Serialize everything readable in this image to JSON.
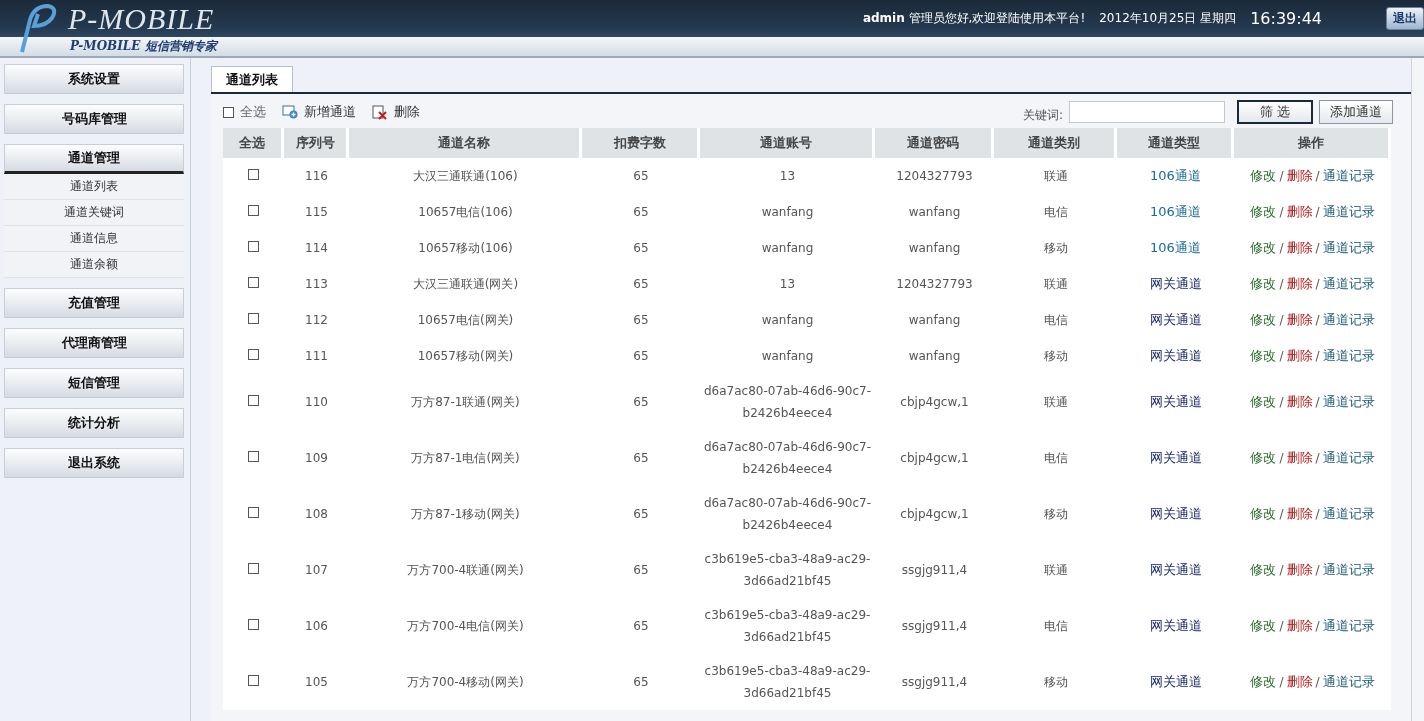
{
  "header": {
    "logo": "P-MOBILE",
    "subtitle": "P-MOBILE 短信营销专家",
    "user": "admin",
    "greeting": "管理员您好,欢迎登陆使用本平台!",
    "date": "2012年10月25日  星期四",
    "time": "16:39:44",
    "logout": "退出"
  },
  "sidebar": [
    {
      "label": "系统设置",
      "expanded": false
    },
    {
      "label": "号码库管理",
      "expanded": false
    },
    {
      "label": "通道管理",
      "expanded": true,
      "children": [
        {
          "label": "通道列表"
        },
        {
          "label": "通道关键词"
        },
        {
          "label": "通道信息"
        },
        {
          "label": "通道余额"
        }
      ]
    },
    {
      "label": "充值管理",
      "expanded": false
    },
    {
      "label": "代理商管理",
      "expanded": false
    },
    {
      "label": "短信管理",
      "expanded": false
    },
    {
      "label": "统计分析",
      "expanded": false
    },
    {
      "label": "退出系统",
      "expanded": false
    }
  ],
  "tab": {
    "label": "通道列表",
    "selected": true
  },
  "toolbar": {
    "select_all": {
      "label": "全选",
      "checked": false
    },
    "add": "新增通道",
    "delete": "删除",
    "keyword_label": "关键词:",
    "filter": "筛 选",
    "add_channel": "添加通道"
  },
  "table": {
    "columns": [
      "全选",
      "序列号",
      "通道名称",
      "扣费字数",
      "通道账号",
      "通道密码",
      "通道类别",
      "通道类型",
      "操作"
    ],
    "rows": [
      {
        "checked": false,
        "id": "116",
        "name": "大汉三通联通(106)",
        "chars": "65",
        "account": [
          "13"
        ],
        "password": "1204327793",
        "carrier": "联通",
        "type": {
          "kind": "sms106",
          "label": "106通道"
        },
        "actions": [
          {
            "kind": "edit",
            "label": "修改"
          },
          {
            "kind": "separator",
            "label": "/"
          },
          {
            "kind": "delete",
            "label": "删除"
          },
          {
            "kind": "separator",
            "label": "/"
          },
          {
            "kind": "log",
            "label": "通道记录"
          }
        ]
      },
      {
        "checked": false,
        "id": "115",
        "name": "10657电信(106)",
        "chars": "65",
        "account": [
          "wanfang"
        ],
        "password": "wanfang",
        "carrier": "电信",
        "type": {
          "kind": "sms106",
          "label": "106通道"
        },
        "actions": [
          {
            "kind": "edit",
            "label": "修改"
          },
          {
            "kind": "separator",
            "label": "/"
          },
          {
            "kind": "delete",
            "label": "删除"
          },
          {
            "kind": "separator",
            "label": "/"
          },
          {
            "kind": "log",
            "label": "通道记录"
          }
        ]
      },
      {
        "checked": false,
        "id": "114",
        "name": "10657移动(106)",
        "chars": "65",
        "account": [
          "wanfang"
        ],
        "password": "wanfang",
        "carrier": "移动",
        "type": {
          "kind": "sms106",
          "label": "106通道"
        },
        "actions": [
          {
            "kind": "edit",
            "label": "修改"
          },
          {
            "kind": "separator",
            "label": "/"
          },
          {
            "kind": "delete",
            "label": "删除"
          },
          {
            "kind": "separator",
            "label": "/"
          },
          {
            "kind": "log",
            "label": "通道记录"
          }
        ]
      },
      {
        "checked": false,
        "id": "113",
        "name": "大汉三通联通(网关)",
        "chars": "65",
        "account": [
          "13"
        ],
        "password": "1204327793",
        "carrier": "联通",
        "type": {
          "kind": "gateway",
          "label": "网关通道"
        },
        "actions": [
          {
            "kind": "edit",
            "label": "修改"
          },
          {
            "kind": "separator",
            "label": "/"
          },
          {
            "kind": "delete",
            "label": "删除"
          },
          {
            "kind": "separator",
            "label": "/"
          },
          {
            "kind": "log",
            "label": "通道记录"
          }
        ]
      },
      {
        "checked": false,
        "id": "112",
        "name": "10657电信(网关)",
        "chars": "65",
        "account": [
          "wanfang"
        ],
        "password": "wanfang",
        "carrier": "电信",
        "type": {
          "kind": "gateway",
          "label": "网关通道"
        },
        "actions": [
          {
            "kind": "edit",
            "label": "修改"
          },
          {
            "kind": "separator",
            "label": "/"
          },
          {
            "kind": "delete",
            "label": "删除"
          },
          {
            "kind": "separator",
            "label": "/"
          },
          {
            "kind": "log",
            "label": "通道记录"
          }
        ]
      },
      {
        "checked": false,
        "id": "111",
        "name": "10657移动(网关)",
        "chars": "65",
        "account": [
          "wanfang"
        ],
        "password": "wanfang",
        "carrier": "移动",
        "type": {
          "kind": "gateway",
          "label": "网关通道"
        },
        "actions": [
          {
            "kind": "edit",
            "label": "修改"
          },
          {
            "kind": "separator",
            "label": "/"
          },
          {
            "kind": "delete",
            "label": "删除"
          },
          {
            "kind": "separator",
            "label": "/"
          },
          {
            "kind": "log",
            "label": "通道记录"
          }
        ]
      },
      {
        "checked": false,
        "id": "110",
        "name": "万方87-1联通(网关)",
        "chars": "65",
        "account": [
          "d6a7ac80-07ab-46d6-90c7-",
          "b2426b4eece4"
        ],
        "password": "cbjp4gcw,1",
        "carrier": "联通",
        "type": {
          "kind": "gateway",
          "label": "网关通道"
        },
        "actions": [
          {
            "kind": "edit",
            "label": "修改"
          },
          {
            "kind": "separator",
            "label": "/"
          },
          {
            "kind": "delete",
            "label": "删除"
          },
          {
            "kind": "separator",
            "label": "/"
          },
          {
            "kind": "log",
            "label": "通道记录"
          }
        ]
      },
      {
        "checked": false,
        "id": "109",
        "name": "万方87-1电信(网关)",
        "chars": "65",
        "account": [
          "d6a7ac80-07ab-46d6-90c7-",
          "b2426b4eece4"
        ],
        "password": "cbjp4gcw,1",
        "carrier": "电信",
        "type": {
          "kind": "gateway",
          "label": "网关通道"
        },
        "actions": [
          {
            "kind": "edit",
            "label": "修改"
          },
          {
            "kind": "separator",
            "label": "/"
          },
          {
            "kind": "delete",
            "label": "删除"
          },
          {
            "kind": "separator",
            "label": "/"
          },
          {
            "kind": "log",
            "label": "通道记录"
          }
        ]
      },
      {
        "checked": false,
        "id": "108",
        "name": "万方87-1移动(网关)",
        "chars": "65",
        "account": [
          "d6a7ac80-07ab-46d6-90c7-",
          "b2426b4eece4"
        ],
        "password": "cbjp4gcw,1",
        "carrier": "移动",
        "type": {
          "kind": "gateway",
          "label": "网关通道"
        },
        "actions": [
          {
            "kind": "edit",
            "label": "修改"
          },
          {
            "kind": "separator",
            "label": "/"
          },
          {
            "kind": "delete",
            "label": "删除"
          },
          {
            "kind": "separator",
            "label": "/"
          },
          {
            "kind": "log",
            "label": "通道记录"
          }
        ]
      },
      {
        "checked": false,
        "id": "107",
        "name": "万方700-4联通(网关)",
        "chars": "65",
        "account": [
          "c3b619e5-cba3-48a9-ac29-",
          "3d66ad21bf45"
        ],
        "password": "ssgjg911,4",
        "carrier": "联通",
        "type": {
          "kind": "gateway",
          "label": "网关通道"
        },
        "actions": [
          {
            "kind": "edit",
            "label": "修改"
          },
          {
            "kind": "separator",
            "label": "/"
          },
          {
            "kind": "delete",
            "label": "删除"
          },
          {
            "kind": "separator",
            "label": "/"
          },
          {
            "kind": "log",
            "label": "通道记录"
          }
        ]
      },
      {
        "checked": false,
        "id": "106",
        "name": "万方700-4电信(网关)",
        "chars": "65",
        "account": [
          "c3b619e5-cba3-48a9-ac29-",
          "3d66ad21bf45"
        ],
        "password": "ssgjg911,4",
        "carrier": "电信",
        "type": {
          "kind": "gateway",
          "label": "网关通道"
        },
        "actions": [
          {
            "kind": "edit",
            "label": "修改"
          },
          {
            "kind": "separator",
            "label": "/"
          },
          {
            "kind": "delete",
            "label": "删除"
          },
          {
            "kind": "separator",
            "label": "/"
          },
          {
            "kind": "log",
            "label": "通道记录"
          }
        ]
      },
      {
        "checked": false,
        "id": "105",
        "name": "万方700-4移动(网关)",
        "chars": "65",
        "account": [
          "c3b619e5-cba3-48a9-ac29-",
          "3d66ad21bf45"
        ],
        "password": "ssgjg911,4",
        "carrier": "移动",
        "type": {
          "kind": "gateway",
          "label": "网关通道"
        },
        "actions": [
          {
            "kind": "edit",
            "label": "修改"
          },
          {
            "kind": "separator",
            "label": "/"
          },
          {
            "kind": "delete",
            "label": "删除"
          },
          {
            "kind": "separator",
            "label": "/"
          },
          {
            "kind": "log",
            "label": "通道记录"
          }
        ]
      }
    ]
  }
}
